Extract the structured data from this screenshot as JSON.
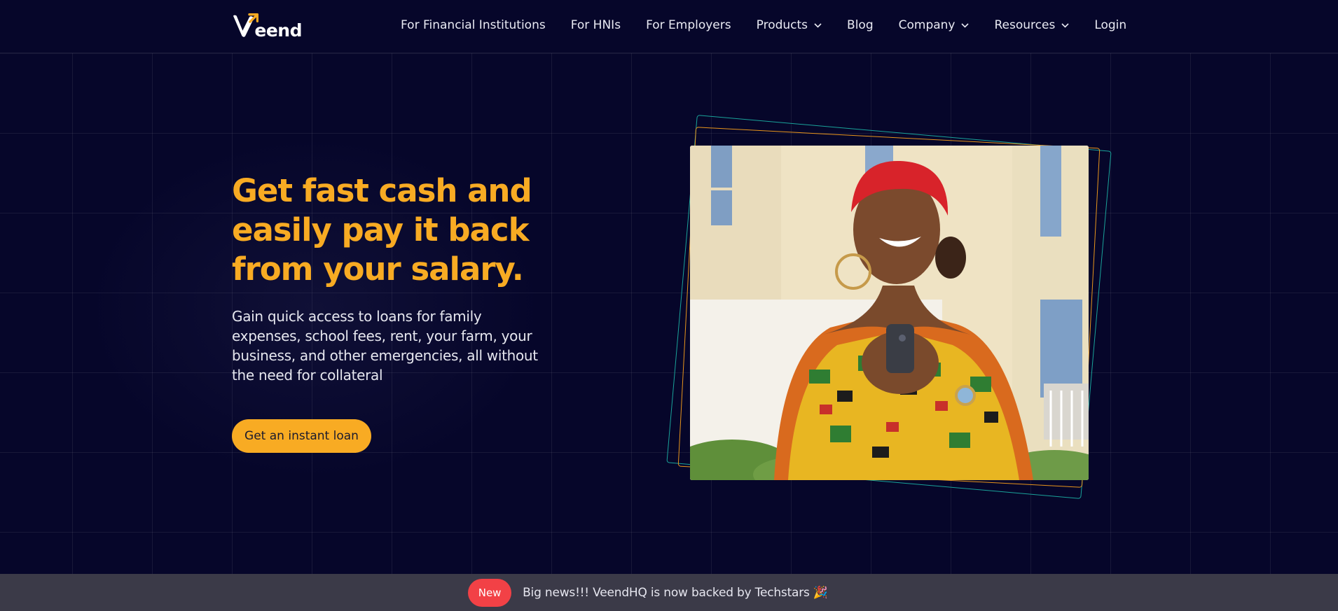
{
  "brand": {
    "name": "eend",
    "logo_icon": "veend-v-logo-icon"
  },
  "colors": {
    "background": "#06062a",
    "accent": "#f8ab23",
    "teal": "#1aa39a",
    "badge_red": "#f24146",
    "banner_bg": "#3b3a48"
  },
  "nav": {
    "items": [
      {
        "label": "For Financial Institutions",
        "has_dropdown": false
      },
      {
        "label": "For HNIs",
        "has_dropdown": false
      },
      {
        "label": "For Employers",
        "has_dropdown": false
      },
      {
        "label": "Products",
        "has_dropdown": true
      },
      {
        "label": "Blog",
        "has_dropdown": false
      },
      {
        "label": "Company",
        "has_dropdown": true
      },
      {
        "label": "Resources",
        "has_dropdown": true
      },
      {
        "label": "Login",
        "has_dropdown": false
      }
    ]
  },
  "hero": {
    "title": "Get fast cash and easily pay it back from your salary.",
    "subtitle": "Gain quick access to loans for family expenses, school fees, rent, your farm, your business, and other emergencies, all without the need for collateral",
    "cta_label": "Get an instant loan"
  },
  "banner": {
    "badge": "New",
    "text": "Big news!!! VeendHQ is now backed by Techstars 🎉"
  }
}
